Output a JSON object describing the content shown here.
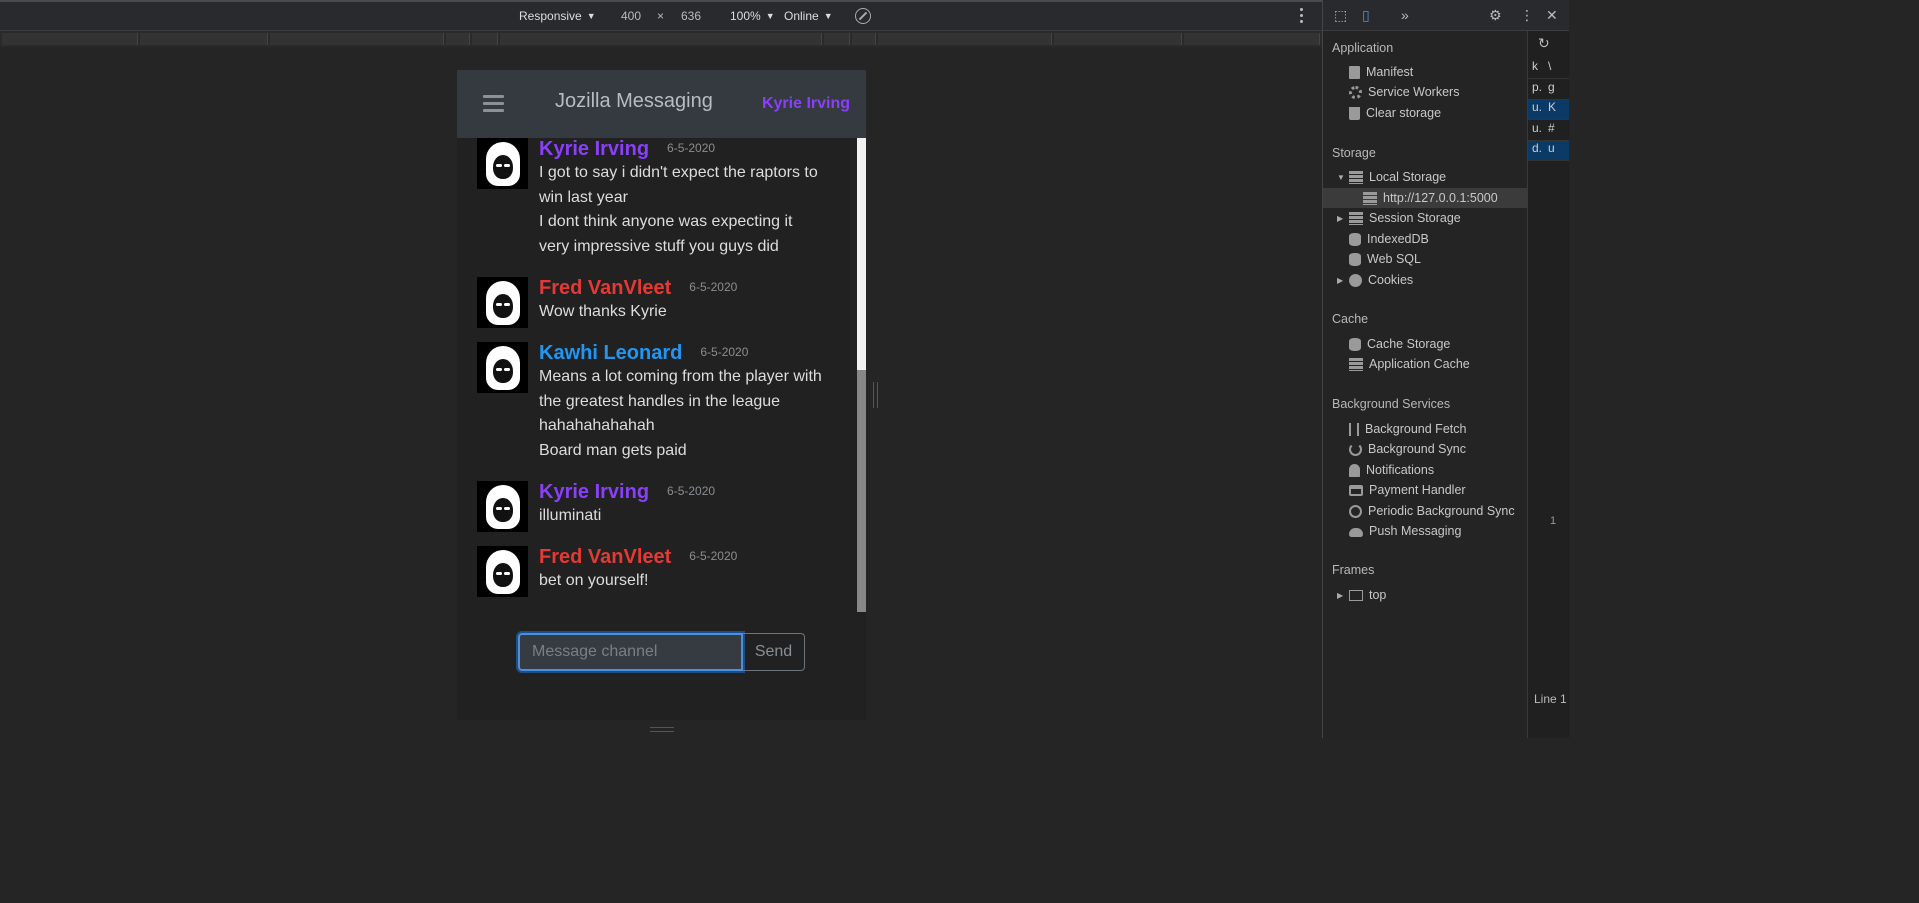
{
  "device_toolbar": {
    "device": "Responsive",
    "width": "400",
    "times": "×",
    "height": "636",
    "zoom": "100%",
    "network": "Online",
    "caret": "▼"
  },
  "app": {
    "title": "Jozilla Messaging",
    "current_user": "Kyrie Irving",
    "messages": [
      {
        "name": "Kyrie Irving",
        "date": "6-5-2020",
        "color": "#8a3ffc",
        "lines": [
          "I got to say i didn't expect the raptors to",
          "win last year",
          "I dont think anyone was expecting it",
          "very impressive stuff you guys did"
        ]
      },
      {
        "name": "Fred VanVleet",
        "date": "6-5-2020",
        "color": "#e53935",
        "lines": [
          "Wow thanks Kyrie"
        ]
      },
      {
        "name": "Kawhi Leonard",
        "date": "6-5-2020",
        "color": "#2196f3",
        "lines": [
          "Means a lot coming from the player with",
          "the greatest handles in the league",
          "hahahahahahah",
          "Board man gets paid"
        ]
      },
      {
        "name": "Kyrie Irving",
        "date": "6-5-2020",
        "color": "#8a3ffc",
        "lines": [
          "illuminati"
        ]
      },
      {
        "name": "Fred VanVleet",
        "date": "6-5-2020",
        "color": "#e53935",
        "lines": [
          "bet on yourself!"
        ]
      }
    ],
    "composer": {
      "placeholder": "Message channel",
      "value": "",
      "send_label": "Send"
    }
  },
  "devtools": {
    "sections": {
      "application": "Application",
      "storage": "Storage",
      "cache": "Cache",
      "background_services": "Background Services",
      "frames": "Frames"
    },
    "application_items": [
      "Manifest",
      "Service Workers",
      "Clear storage"
    ],
    "storage_items": [
      "Local Storage",
      "http://127.0.0.1:5000",
      "Session Storage",
      "IndexedDB",
      "Web SQL",
      "Cookies"
    ],
    "cache_items": [
      "Cache Storage",
      "Application Cache"
    ],
    "background_items": [
      "Background Fetch",
      "Background Sync",
      "Notifications",
      "Payment Handler",
      "Periodic Background Sync",
      "Push Messaging"
    ],
    "frames_items": [
      "top"
    ],
    "table_rows": [
      {
        "k": "k",
        "v": "\\"
      },
      {
        "k": "p.",
        "v": "g"
      },
      {
        "k": "u.",
        "v": "K"
      },
      {
        "k": "u.",
        "v": "#"
      },
      {
        "k": "d.",
        "v": "u"
      }
    ],
    "line_number": "1",
    "status": "Line 1"
  }
}
